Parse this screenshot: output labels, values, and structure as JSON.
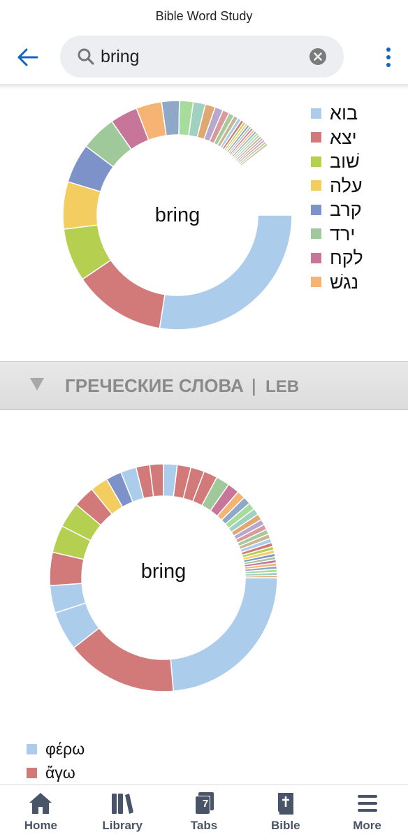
{
  "app": {
    "title": "Bible Word Study"
  },
  "search": {
    "query": "bring"
  },
  "hebrew_chart": {
    "center_label": "bring",
    "legend": [
      {
        "word": "בוא",
        "color": "#abcdeb"
      },
      {
        "word": "יצא",
        "color": "#d27a7a"
      },
      {
        "word": "שׁוב",
        "color": "#b5cf50"
      },
      {
        "word": "עלה",
        "color": "#f3cd60"
      },
      {
        "word": "קרב",
        "color": "#7d92c8"
      },
      {
        "word": "ירד",
        "color": "#9fc99a"
      },
      {
        "word": "לקח",
        "color": "#c8759a"
      },
      {
        "word": "נגשׁ",
        "color": "#f6b474"
      }
    ]
  },
  "greek_section": {
    "title": "ГРЕЧЕСКИЕ СЛОВА",
    "separator": "|",
    "version": "LEB"
  },
  "greek_chart": {
    "center_label": "bring",
    "legend": [
      {
        "word": "φέρω",
        "color": "#abcdeb"
      },
      {
        "word": "ἄγω",
        "color": "#d27a7a"
      }
    ]
  },
  "nav": {
    "tabs_count": "7",
    "items": [
      {
        "label": "Home",
        "icon": "home-icon"
      },
      {
        "label": "Library",
        "icon": "library-icon"
      },
      {
        "label": "Tabs",
        "icon": "tabs-icon"
      },
      {
        "label": "Bible",
        "icon": "bible-icon"
      },
      {
        "label": "More",
        "icon": "more-icon"
      }
    ]
  }
}
